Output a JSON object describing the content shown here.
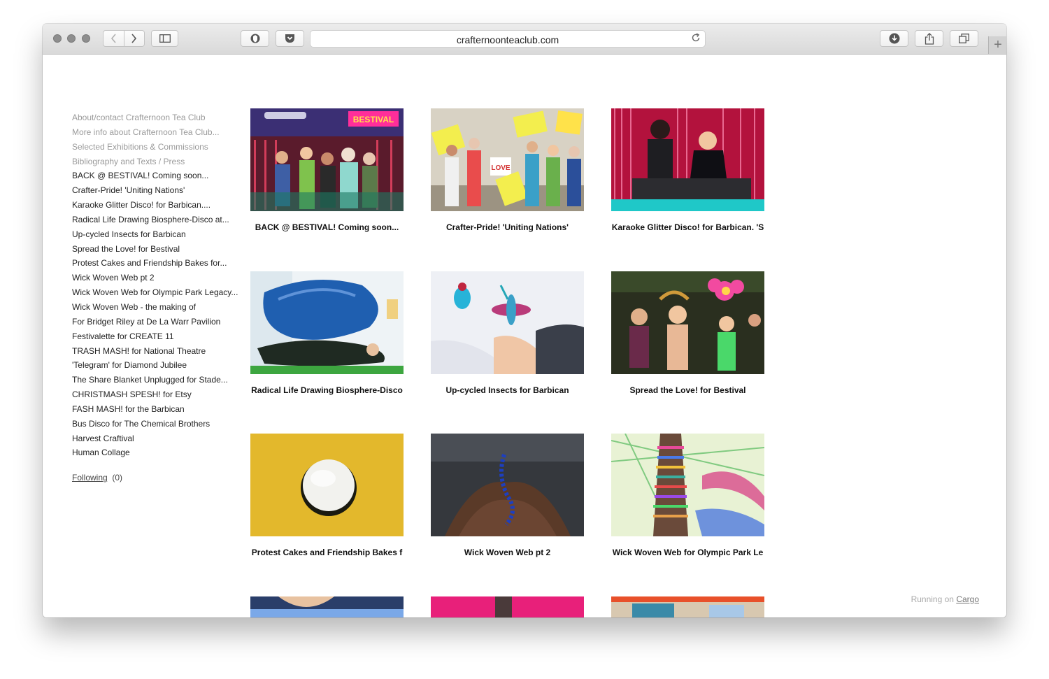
{
  "browser": {
    "url": "crafternoonteaclub.com",
    "icons": {
      "back": "chevron-left-icon",
      "forward": "chevron-right-icon",
      "sidebar": "sidebar-icon",
      "reload": "reload-icon",
      "download": "download-icon",
      "share": "share-icon",
      "tabs": "tabs-icon",
      "newtab": "plus-icon"
    }
  },
  "sidebar": {
    "links": [
      {
        "label": "About/contact Crafternoon Tea Club",
        "muted": true
      },
      {
        "label": "More info about Crafternoon Tea Club...",
        "muted": true
      },
      {
        "label": "Selected Exhibitions & Commissions",
        "muted": true
      },
      {
        "label": "Bibliography and Texts / Press",
        "muted": true
      },
      {
        "label": "BACK @ BESTIVAL! Coming soon...",
        "muted": false
      },
      {
        "label": "Crafter-Pride! 'Uniting Nations'",
        "muted": false
      },
      {
        "label": "Karaoke Glitter Disco! for Barbican....",
        "muted": false
      },
      {
        "label": "Radical Life Drawing Biosphere-Disco at...",
        "muted": false
      },
      {
        "label": "Up-cycled Insects for Barbican",
        "muted": false
      },
      {
        "label": "Spread the Love! for Bestival",
        "muted": false
      },
      {
        "label": "Protest Cakes and Friendship Bakes for...",
        "muted": false
      },
      {
        "label": "Wick Woven Web pt 2",
        "muted": false
      },
      {
        "label": "Wick Woven Web for Olympic Park Legacy...",
        "muted": false
      },
      {
        "label": "Wick Woven Web - the making of",
        "muted": false
      },
      {
        "label": "For Bridget Riley at De La Warr Pavilion",
        "muted": false
      },
      {
        "label": "Festivalette for CREATE 11",
        "muted": false
      },
      {
        "label": "TRASH MASH! for National Theatre",
        "muted": false
      },
      {
        "label": "'Telegram' for Diamond Jubilee",
        "muted": false
      },
      {
        "label": "The Share Blanket Unplugged for Stade...",
        "muted": false
      },
      {
        "label": "CHRISTMASH SPESH! for Etsy",
        "muted": false
      },
      {
        "label": "FASH MASH! for the Barbican",
        "muted": false
      },
      {
        "label": "Bus Disco for The Chemical Brothers",
        "muted": false
      },
      {
        "label": "Harvest Craftival",
        "muted": false
      },
      {
        "label": "Human Collage",
        "muted": false
      }
    ],
    "following_label": "Following",
    "following_count": "(0)"
  },
  "grid": {
    "projects": [
      {
        "caption": "BACK @ BESTIVAL! Coming soon...",
        "sign": "BESTIVAL"
      },
      {
        "caption": "Crafter-Pride! 'Uniting Nations'",
        "sign": "LOVE"
      },
      {
        "caption": "Karaoke Glitter Disco! for Barbican. 'S",
        "sign": ""
      },
      {
        "caption": "Radical Life Drawing Biosphere-Disco",
        "sign": ""
      },
      {
        "caption": "Up-cycled Insects for Barbican",
        "sign": ""
      },
      {
        "caption": "Spread the Love! for Bestival",
        "sign": ""
      },
      {
        "caption": "Protest Cakes and Friendship Bakes f",
        "sign": ""
      },
      {
        "caption": "Wick Woven Web pt 2",
        "sign": ""
      },
      {
        "caption": "Wick Woven Web for Olympic Park Le",
        "sign": ""
      },
      {
        "caption": "",
        "sign": ""
      },
      {
        "caption": "",
        "sign": ""
      },
      {
        "caption": "",
        "sign": ""
      }
    ]
  },
  "footer": {
    "running_on": "Running on",
    "platform": "Cargo"
  }
}
